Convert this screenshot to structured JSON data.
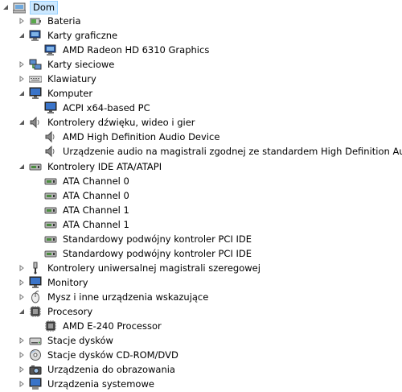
{
  "root": {
    "label": "Dom",
    "icon": "computer-icon"
  },
  "nodes": [
    {
      "label": "Bateria",
      "icon": "battery-icon",
      "level": 1,
      "state": "collapsed"
    },
    {
      "label": "Karty graficzne",
      "icon": "display-adapter-icon",
      "level": 1,
      "state": "expanded"
    },
    {
      "label": "AMD Radeon HD 6310 Graphics",
      "icon": "display-adapter-icon",
      "level": 2,
      "state": "leaf"
    },
    {
      "label": "Karty sieciowe",
      "icon": "network-adapter-icon",
      "level": 1,
      "state": "collapsed"
    },
    {
      "label": "Klawiatury",
      "icon": "keyboard-icon",
      "level": 1,
      "state": "collapsed"
    },
    {
      "label": "Komputer",
      "icon": "monitor-icon",
      "level": 1,
      "state": "expanded"
    },
    {
      "label": "ACPI x64-based PC",
      "icon": "monitor-icon",
      "level": 2,
      "state": "leaf"
    },
    {
      "label": "Kontrolery dźwięku, wideo i gier",
      "icon": "speaker-icon",
      "level": 1,
      "state": "expanded"
    },
    {
      "label": "AMD High Definition Audio Device",
      "icon": "speaker-icon",
      "level": 2,
      "state": "leaf"
    },
    {
      "label": "Urządzenie audio na magistrali zgodnej ze standardem High Definition Audio",
      "icon": "speaker-icon",
      "level": 2,
      "state": "leaf"
    },
    {
      "label": "Kontrolery IDE ATA/ATAPI",
      "icon": "ide-controller-icon",
      "level": 1,
      "state": "expanded"
    },
    {
      "label": "ATA Channel 0",
      "icon": "ide-controller-icon",
      "level": 2,
      "state": "leaf"
    },
    {
      "label": "ATA Channel 0",
      "icon": "ide-controller-icon",
      "level": 2,
      "state": "leaf"
    },
    {
      "label": "ATA Channel 1",
      "icon": "ide-controller-icon",
      "level": 2,
      "state": "leaf"
    },
    {
      "label": "ATA Channel 1",
      "icon": "ide-controller-icon",
      "level": 2,
      "state": "leaf"
    },
    {
      "label": "Standardowy podwójny kontroler PCI IDE",
      "icon": "ide-controller-icon",
      "level": 2,
      "state": "leaf"
    },
    {
      "label": "Standardowy podwójny kontroler PCI IDE",
      "icon": "ide-controller-icon",
      "level": 2,
      "state": "leaf"
    },
    {
      "label": "Kontrolery uniwersalnej magistrali szeregowej",
      "icon": "usb-icon",
      "level": 1,
      "state": "collapsed"
    },
    {
      "label": "Monitory",
      "icon": "monitor-icon",
      "level": 1,
      "state": "collapsed"
    },
    {
      "label": "Mysz i inne urządzenia wskazujące",
      "icon": "mouse-icon",
      "level": 1,
      "state": "collapsed"
    },
    {
      "label": "Procesory",
      "icon": "processor-icon",
      "level": 1,
      "state": "expanded"
    },
    {
      "label": "AMD E-240 Processor",
      "icon": "processor-icon",
      "level": 2,
      "state": "leaf"
    },
    {
      "label": "Stacje dysków",
      "icon": "disk-drive-icon",
      "level": 1,
      "state": "collapsed"
    },
    {
      "label": "Stacje dysków CD-ROM/DVD",
      "icon": "cdrom-icon",
      "level": 1,
      "state": "collapsed"
    },
    {
      "label": "Urządzenia do obrazowania",
      "icon": "camera-icon",
      "level": 1,
      "state": "collapsed"
    },
    {
      "label": "Urządzenia systemowe",
      "icon": "system-device-icon",
      "level": 1,
      "state": "collapsed"
    }
  ]
}
